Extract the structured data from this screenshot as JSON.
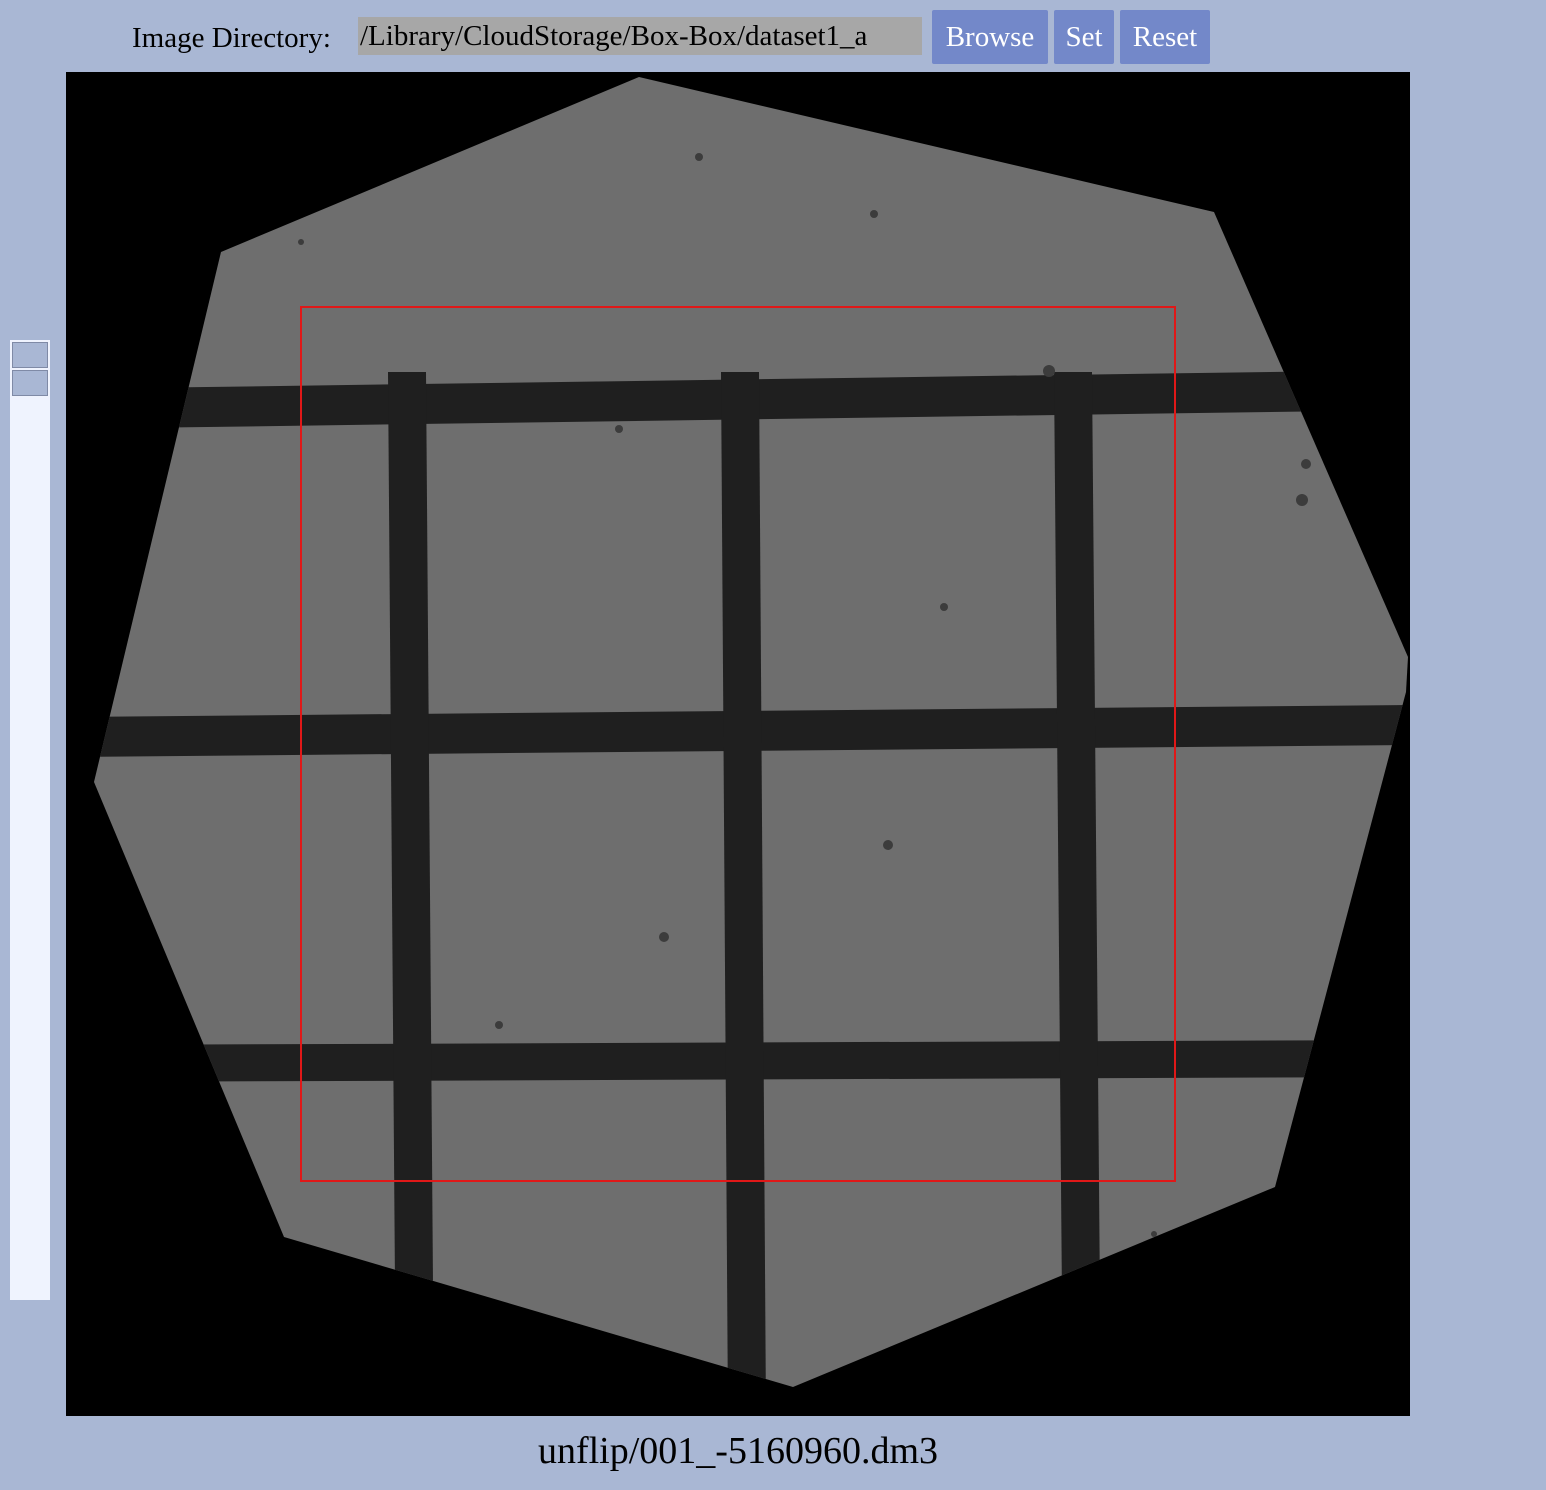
{
  "toolbar": {
    "directory_label": "Image Directory:",
    "directory_value": "/Library/CloudStorage/Box-Box/dataset1_a",
    "browse_label": "Browse",
    "set_label": "Set",
    "reset_label": "Reset"
  },
  "image": {
    "filename": "unflip/001_-5160960.dm3"
  }
}
